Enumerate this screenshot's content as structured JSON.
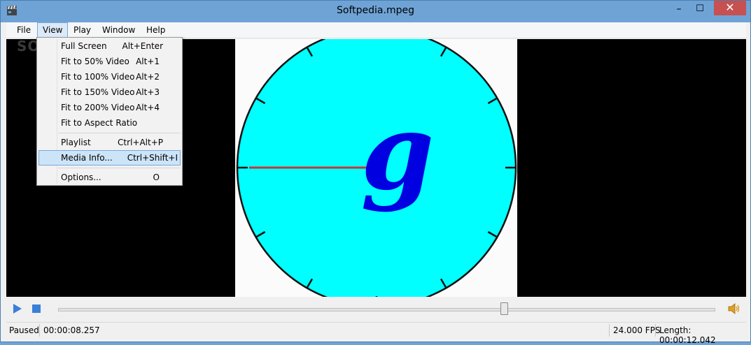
{
  "window": {
    "title": "Softpedia.mpeg",
    "minimize": "–",
    "maximize": "☐",
    "close": "✕"
  },
  "menubar": {
    "items": [
      "File",
      "View",
      "Play",
      "Window",
      "Help"
    ],
    "active": "View"
  },
  "view_menu": [
    {
      "label": "Full Screen",
      "shortcut": "Alt+Enter"
    },
    {
      "label": "Fit to 50% Video",
      "shortcut": "Alt+1"
    },
    {
      "label": "Fit to 100% Video",
      "shortcut": "Alt+2"
    },
    {
      "label": "Fit to 150% Video",
      "shortcut": "Alt+3"
    },
    {
      "label": "Fit to 200% Video",
      "shortcut": "Alt+4"
    },
    {
      "label": "Fit to Aspect Ratio",
      "shortcut": ""
    },
    {
      "label": "Playlist",
      "shortcut": "Ctrl+Alt+P"
    },
    {
      "label": "Media Info...",
      "shortcut": "Ctrl+Shift+I",
      "highlighted": true
    },
    {
      "label": "Options...",
      "shortcut": "O"
    }
  ],
  "video": {
    "watermark": "SOFTPEDIA",
    "clock_letter": "g"
  },
  "controls": {
    "play_icon": "play-icon",
    "stop_icon": "stop-icon",
    "volume_icon": "volume-icon",
    "seek_fraction": 0.68
  },
  "status": {
    "state": "Paused",
    "position": "00:00:08.257",
    "fps": "24.000 FPS",
    "length": "Length: 00:00:12.042"
  },
  "colors": {
    "accent": "#3a7fd8",
    "clock_face": "#00ffff",
    "hand": "#cc3333",
    "letter": "#0000e0"
  }
}
